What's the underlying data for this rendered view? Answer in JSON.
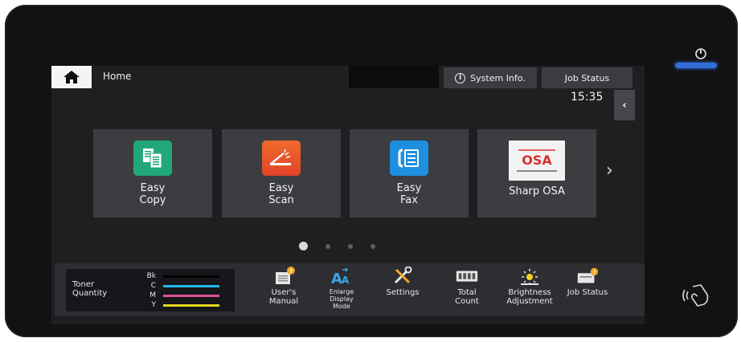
{
  "header": {
    "home_label": "Home",
    "system_info_label": "System Info.",
    "job_status_label": "Job Status",
    "clock": "15:35"
  },
  "tiles": [
    {
      "line1": "Easy",
      "line2": "Copy",
      "icon": "copy-icon",
      "color": "#21a878"
    },
    {
      "line1": "Easy",
      "line2": "Scan",
      "icon": "scan-icon",
      "color": "#e8522a"
    },
    {
      "line1": "Easy",
      "line2": "Fax",
      "icon": "fax-icon",
      "color": "#1e8ee0"
    },
    {
      "line1": "Sharp OSA",
      "line2": "",
      "icon": "sharp-osa-icon",
      "color": "#ffffff"
    }
  ],
  "pager": {
    "count": 4,
    "active": 0
  },
  "toner": {
    "title_line1": "Toner",
    "title_line2": "Quantity",
    "levels": [
      {
        "key": "Bk",
        "color": "#000000"
      },
      {
        "key": "C",
        "color": "#22b8e8"
      },
      {
        "key": "M",
        "color": "#e0509a"
      },
      {
        "key": "Y",
        "color": "#e8d820"
      }
    ]
  },
  "bottom_items": [
    {
      "label": "User's\nManual",
      "icon": "users-manual-icon"
    },
    {
      "label": "Enlarge\nDisplay\nMode",
      "icon": "enlarge-display-icon"
    },
    {
      "label": "Settings",
      "icon": "settings-icon"
    },
    {
      "label": "Total\nCount",
      "icon": "total-count-icon"
    },
    {
      "label": "Brightness\nAdjustment",
      "icon": "brightness-icon"
    },
    {
      "label": "Job Status",
      "icon": "job-status-icon"
    }
  ],
  "colors": {
    "accent_blue": "#2f6fd6",
    "notify_orange": "#f5a623"
  }
}
